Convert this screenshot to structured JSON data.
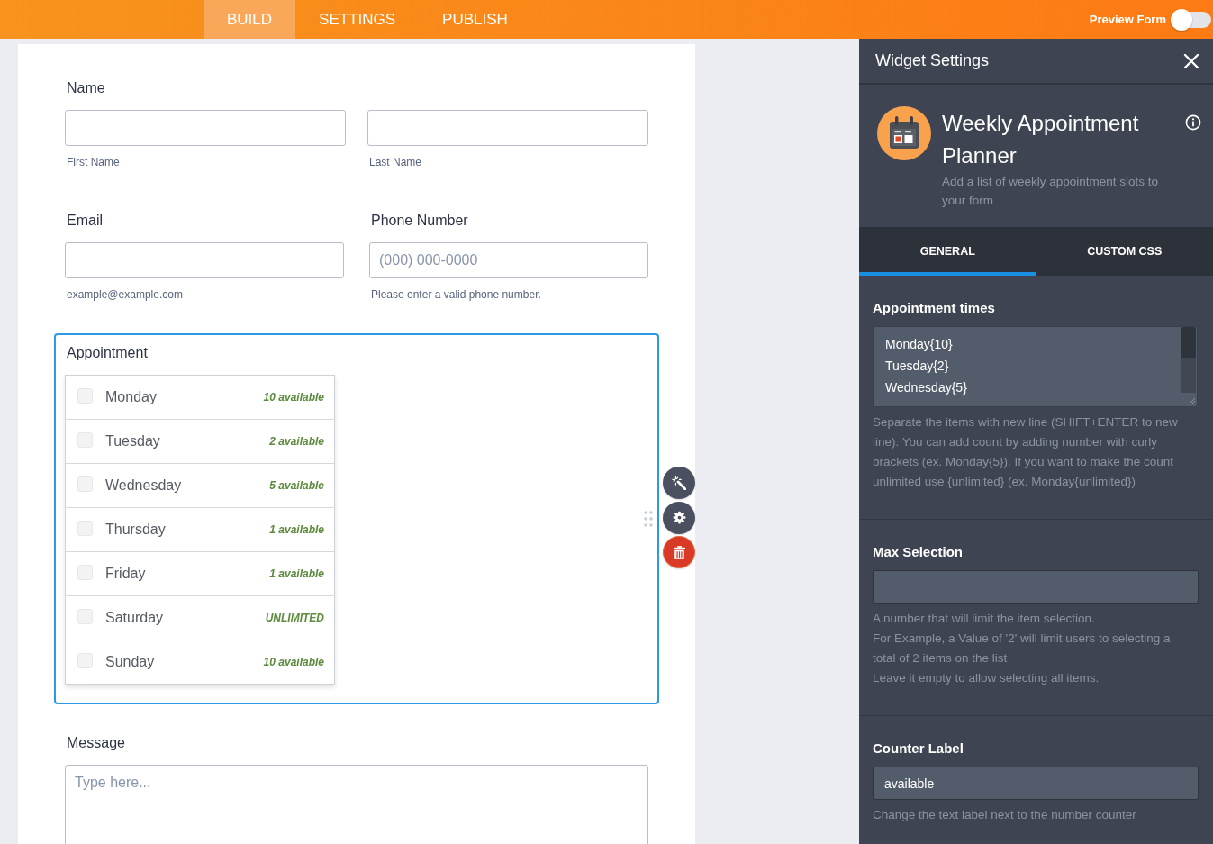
{
  "top_bar": {
    "tabs": [
      {
        "label": "BUILD",
        "selected": true
      },
      {
        "label": "SETTINGS",
        "selected": false
      },
      {
        "label": "PUBLISH",
        "selected": false
      }
    ],
    "preview_toggle": {
      "label": "Preview Form",
      "on": false
    }
  },
  "form": {
    "fields": [
      {
        "kind": "name",
        "label": "Name",
        "inputs": [
          {
            "sublabel": "First Name"
          },
          {
            "sublabel": "Last Name"
          }
        ]
      },
      {
        "kind": "columns",
        "columns": [
          {
            "label": "Email",
            "sublabel": "example@example.com"
          },
          {
            "label": "Phone Number",
            "placeholder": "(000) 000-0000",
            "sublabel": "Please enter a valid phone number."
          }
        ]
      },
      {
        "kind": "checklist",
        "label": "Appointment",
        "selected": true,
        "tools": [
          {
            "kind": "wand"
          },
          {
            "kind": "gear"
          },
          {
            "kind": "delete"
          }
        ],
        "options": [
          {
            "label": "Monday",
            "count": "10 available",
            "checked": false
          },
          {
            "label": "Tuesday",
            "count": "2 available",
            "checked": false
          },
          {
            "label": "Wednesday",
            "count": "5 available",
            "checked": false
          },
          {
            "label": "Thursday",
            "count": "1 available",
            "checked": false
          },
          {
            "label": "Friday",
            "count": "1 available",
            "checked": false
          },
          {
            "label": "Saturday",
            "count": "UNLIMITED",
            "checked": false
          },
          {
            "label": "Sunday",
            "count": "10 available",
            "checked": false
          }
        ]
      },
      {
        "kind": "textarea",
        "label": "Message",
        "placeholder": "Type here..."
      }
    ]
  },
  "settings_panel": {
    "title": "Widget Settings",
    "widget": {
      "name": "Weekly Appointment Planner",
      "description": "Add a list of weekly appointment slots to your form"
    },
    "tabs": [
      {
        "label": "GENERAL",
        "selected": true
      },
      {
        "label": "CUSTOM CSS",
        "selected": false
      }
    ],
    "sections": [
      {
        "kind": "textarea",
        "label": "Appointment times",
        "lines": [
          "Monday{10}",
          "Tuesday{2}",
          "Wednesday{5}"
        ],
        "help": [
          "Separate the items with new line (SHIFT+ENTER to new line). You can add count by adding number with curly brackets (ex. Monday{5}). If you want to make the count unlimited use {unlimited} (ex. Monday{unlimited})"
        ]
      },
      {
        "kind": "input",
        "label": "Max Selection",
        "help": [
          "A number that will limit the item selection.",
          "For Example, a Value of '2' will limit users to selecting a total of 2 items on the list",
          "Leave it empty to allow selecting all items."
        ]
      },
      {
        "kind": "input",
        "label": "Counter Label",
        "value": "available",
        "help": [
          "Change the text label next to the number counter"
        ]
      }
    ]
  }
}
